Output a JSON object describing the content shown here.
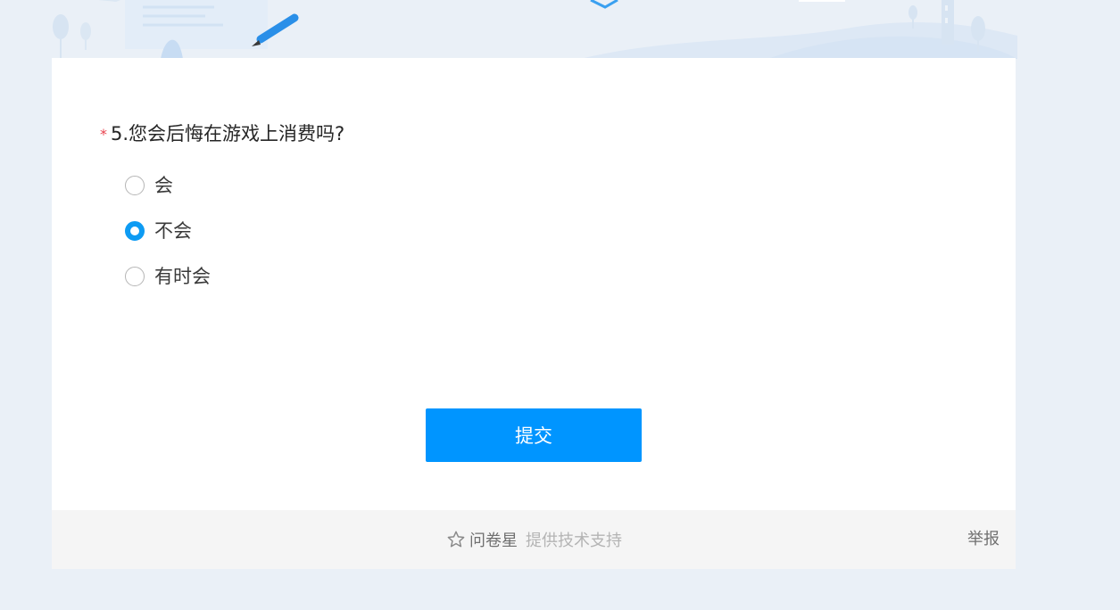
{
  "question": {
    "required_mark": "*",
    "title": "5.您会后悔在游戏上消费吗?"
  },
  "options": [
    {
      "label": "会",
      "checked": false
    },
    {
      "label": "不会",
      "checked": true
    },
    {
      "label": "有时会",
      "checked": false
    }
  ],
  "submit_label": "提交",
  "footer": {
    "brand": "问卷星",
    "support_text": "提供技术支持",
    "report_label": "举报"
  },
  "colors": {
    "accent": "#0095ff",
    "radio_checked": "#0d9bf3",
    "page_bg": "#eaf0f7",
    "required": "#e9424e"
  }
}
